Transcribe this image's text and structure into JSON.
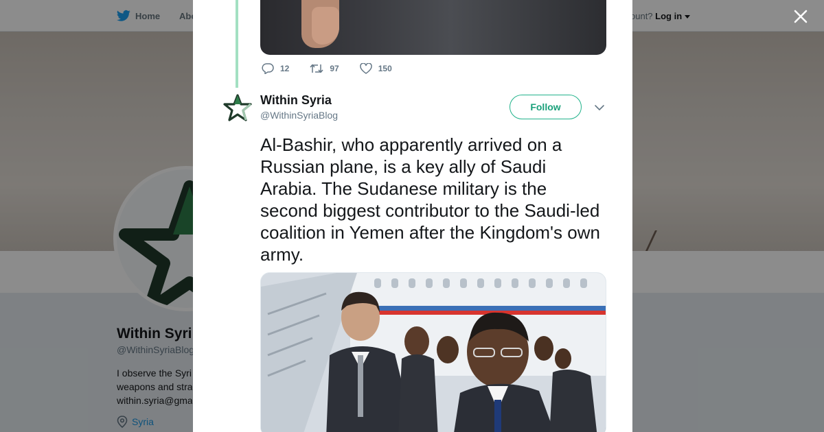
{
  "background": {
    "nav": {
      "home_label": "Home",
      "about_label": "Abo",
      "account_prompt": "ccount?",
      "login_label": "Log in"
    },
    "profile": {
      "name": "Within Syri",
      "handle": "@WithinSyriaBlog",
      "bio_lines": [
        "I observe the Syri",
        "weapons and stra",
        "within.syria@gma"
      ],
      "location": "Syria"
    }
  },
  "modal": {
    "previous_tweet": {
      "reply_count": "12",
      "retweet_count": "97",
      "like_count": "150"
    },
    "tweet": {
      "name": "Within Syria",
      "handle": "@WithinSyriaBlog",
      "follow_label": "Follow",
      "text": "Al-Bashir, who apparently arrived on a Russian plane, is a key ally of Saudi Arabia. The Sudanese military is the second biggest contributor to the Saudi-led coalition in Yemen after the Kingdom's own army."
    }
  },
  "colors": {
    "brand_twitter": "#1da1f2",
    "follow_accent": "#1aa07a",
    "thread_line": "#a3e0c2",
    "avatar_star_dark": "#1f3a2a",
    "avatar_star_green": "#2e7d4a"
  },
  "icons": [
    "twitter-bird-icon",
    "caret-down-icon",
    "close-icon",
    "reply-icon",
    "retweet-icon",
    "like-icon",
    "chevron-down-icon",
    "location-pin-icon",
    "star-avatar-icon"
  ]
}
